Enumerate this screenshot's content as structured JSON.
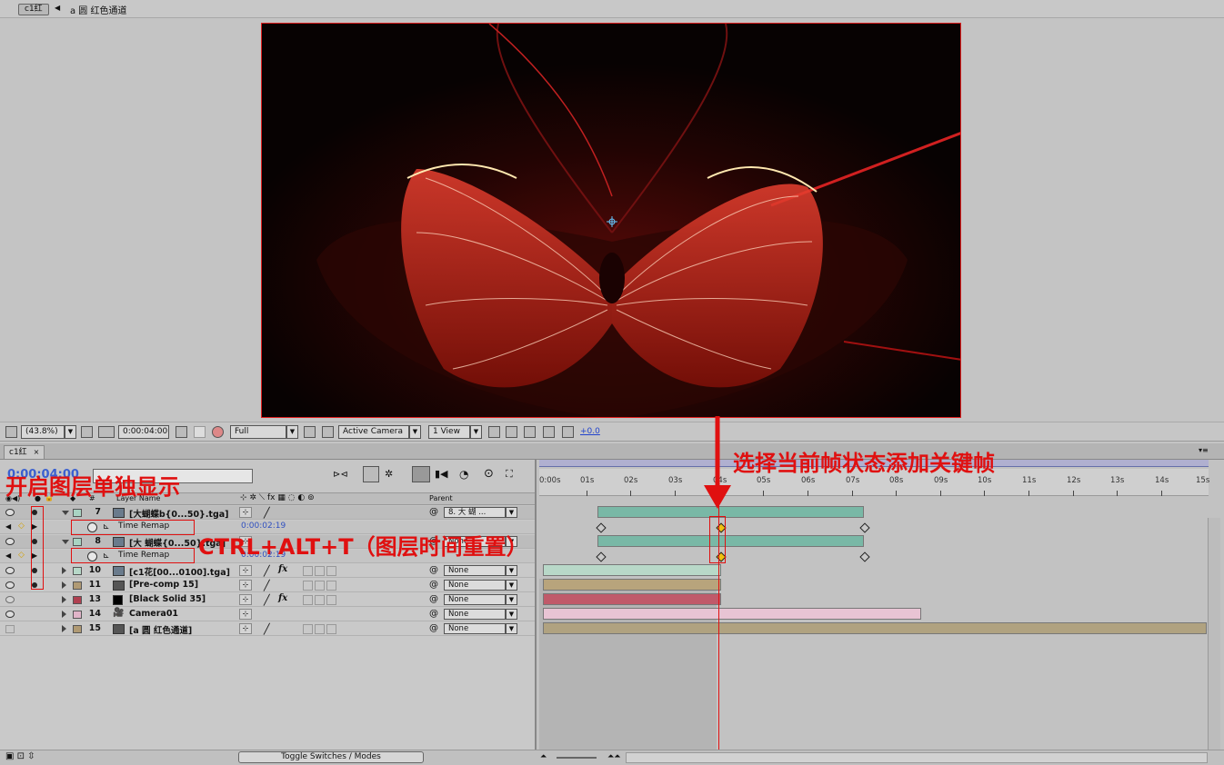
{
  "breadcrumb": {
    "comp_tab": "c1红",
    "layer_path": "a 圆 红色通道"
  },
  "toolbar": {
    "zoom": "(43.8%)",
    "timecode": "0:00:04:00",
    "resolution": "Full",
    "camera": "Active Camera",
    "views": "1 View",
    "exposure": "+0.0"
  },
  "timeline": {
    "tab_label": "c1红",
    "current_time": "0:00:04:00",
    "columns": {
      "number": "#",
      "layer_name": "Layer Name",
      "parent": "Parent"
    },
    "ruler_ticks": [
      "0:00s",
      "01s",
      "02s",
      "03s",
      "04s",
      "05s",
      "06s",
      "07s",
      "08s",
      "09s",
      "10s",
      "11s",
      "12s",
      "13s",
      "14s",
      "15s"
    ],
    "layers": [
      {
        "number": "7",
        "name": "[大蝴蝶b{0...50}.tga]",
        "parent": "8. 大 蝴 ...",
        "label_color": "#a9d4c3",
        "bar_color": "#79b8a6",
        "fx": false
      },
      {
        "sub": true,
        "property": "Time Remap",
        "value": "0:00:02:19"
      },
      {
        "number": "8",
        "name": "[大 蝴蝶{0...50}.tga]",
        "parent": "None",
        "label_color": "#a9d4c3",
        "bar_color": "#79b8a6",
        "fx": false
      },
      {
        "sub": true,
        "property": "Time Remap",
        "value": "0:00:02:19"
      },
      {
        "number": "10",
        "name": "[c1花[00...0100].tga]",
        "parent": "None",
        "label_color": "#b7d8c8",
        "bar_color": "#b8d8c8",
        "fx": true
      },
      {
        "number": "11",
        "name": "[Pre-comp 15]",
        "parent": "None",
        "label_color": "#b09a74",
        "bar_color": "#b8a47c",
        "fx": false
      },
      {
        "number": "13",
        "name": "[Black Solid 35]",
        "parent": "None",
        "label_color": "#b04050",
        "bar_color": "#c05a6a",
        "fx": true
      },
      {
        "number": "14",
        "name": "Camera01",
        "parent": "None",
        "label_color": "#e0b4c8",
        "bar_color": "#e8c4d4",
        "fx": false
      },
      {
        "number": "15",
        "name": "[a 圆 红色通道]",
        "parent": "None",
        "label_color": "#b09a74",
        "bar_color": "#b0a280",
        "fx": false
      }
    ]
  },
  "status": {
    "toggle_label": "Toggle Switches / Modes"
  },
  "annotations": {
    "solo_label": "开启图层单独显示",
    "shortcut_label": "CTRL+ALT+T（图层时间重置）",
    "keyframe_label": "选择当前帧状态添加关键帧"
  },
  "colors": {
    "annotation": "#e01010",
    "cti": "#e01010",
    "keyframe_highlight": "#f0c010"
  }
}
